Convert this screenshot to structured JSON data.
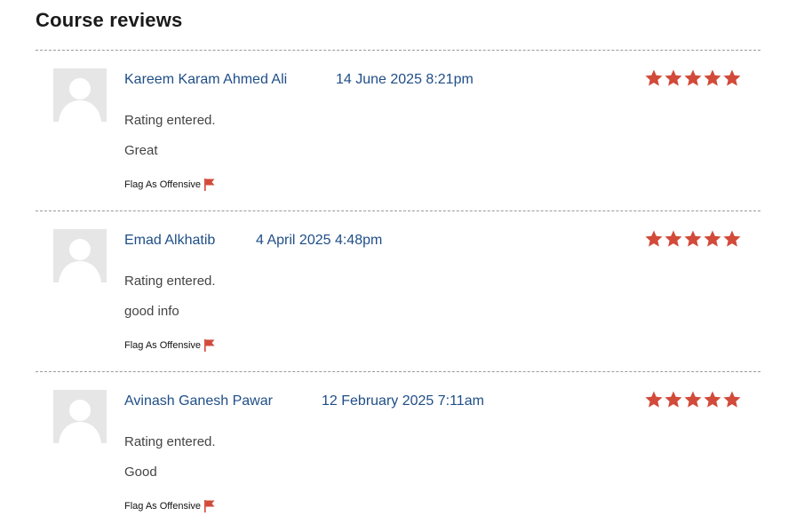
{
  "page": {
    "title": "Course reviews"
  },
  "colors": {
    "author": "#1f4e87",
    "star": "#d24a3a",
    "flag": "#d24a3a",
    "avatar_bg": "#e6e6e6"
  },
  "reviews": [
    {
      "author": "Kareem Karam Ahmed Ali",
      "date": "14 June 2025 8:21pm",
      "rating": 5,
      "rating_max": 5,
      "status": "Rating entered.",
      "comment": "Great",
      "flag_label": "Flag As Offensive"
    },
    {
      "author": "Emad Alkhatib",
      "date": "4 April 2025 4:48pm",
      "rating": 5,
      "rating_max": 5,
      "status": "Rating entered.",
      "comment": "good info",
      "flag_label": "Flag As Offensive"
    },
    {
      "author": "Avinash Ganesh Pawar",
      "date": "12 February 2025 7:11am",
      "rating": 5,
      "rating_max": 5,
      "status": "Rating entered.",
      "comment": "Good",
      "flag_label": "Flag As Offensive"
    }
  ],
  "icons": {
    "avatar": "user-silhouette-icon",
    "star": "star-icon",
    "flag": "flag-icon"
  }
}
